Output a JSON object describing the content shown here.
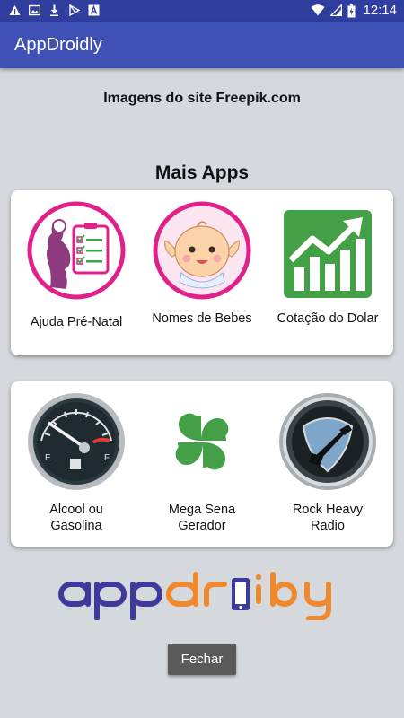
{
  "status_bar": {
    "time": "12:14",
    "left_icons": [
      "alert-icon",
      "image-icon",
      "download-icon",
      "play-store-icon",
      "font-icon"
    ],
    "right_icons": [
      "wifi-icon",
      "cellular-icon",
      "battery-charging-icon"
    ]
  },
  "app_bar": {
    "title": "AppDroidly"
  },
  "credit_text": "Imagens do site Freepik.com",
  "section_title": "Mais Apps",
  "apps_row1": [
    {
      "label": "Ajuda Pré-Natal",
      "icon": "pregnant-checklist-icon"
    },
    {
      "label": "Nomes de Bebes",
      "icon": "baby-face-icon"
    },
    {
      "label": "Cotação do Dolar",
      "icon": "trend-chart-icon"
    }
  ],
  "apps_row2": [
    {
      "label": "Alcool ou Gasolina",
      "icon": "fuel-gauge-icon"
    },
    {
      "label": "Mega Sena Gerador",
      "icon": "four-leaf-clover-icon"
    },
    {
      "label": "Rock Heavy Radio",
      "icon": "guitar-pick-icon"
    }
  ],
  "logo_text": "appdroidly",
  "close_button": "Fechar",
  "colors": {
    "status_bar": "#303f9f",
    "app_bar": "#3f51b5",
    "background": "#d5d8dc",
    "logo_blue": "#3f3a9a",
    "logo_orange": "#f0882d",
    "button": "#5a5a5a"
  }
}
